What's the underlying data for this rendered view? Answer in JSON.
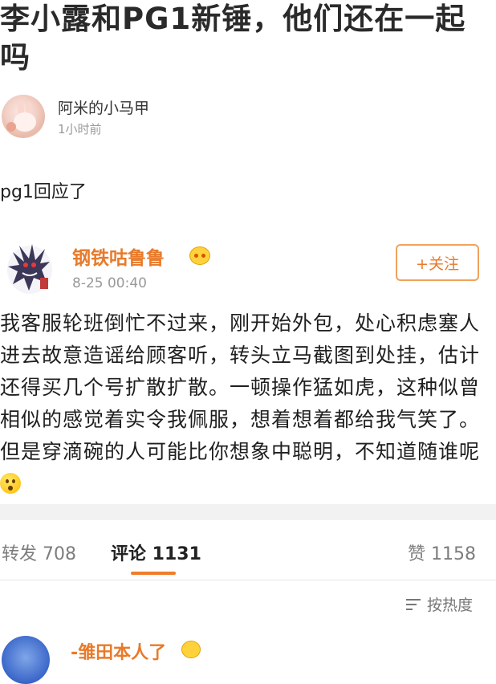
{
  "post": {
    "title": "李小露和PG1新锤，他们还在一起吗",
    "author_name": "阿米的小马甲",
    "author_time": "1小时前",
    "body": "pg1回应了"
  },
  "comment": {
    "username": "钢铁咕鲁鲁",
    "time": "8-25 00:40",
    "follow_label": "+关注",
    "body": "我客服轮班倒忙不过来，刚开始外包，处心积虑塞人进去故意造谣给顾客听，转头立马截图到处挂，估计还得买几个号扩散扩散。一顿操作猛如虎，这种似曾相似的感觉着实令我佩服，想着想着都给我气笑了。但是穿滴碗的人可能比你想象中聪明，不知道随谁呢"
  },
  "tabs": {
    "repost": "转发 708",
    "comments": "评论 1131",
    "likes": "赞 1158"
  },
  "sort_label": "按热度",
  "next_comment": {
    "username": "-雏田本人了"
  },
  "colors": {
    "accent": "#e87a2a",
    "follow_border": "#f0a25c",
    "underline": "#f07d2c"
  },
  "icons": [
    "vip-crown-icon",
    "sort-icon",
    "surprised-emoji-icon"
  ]
}
